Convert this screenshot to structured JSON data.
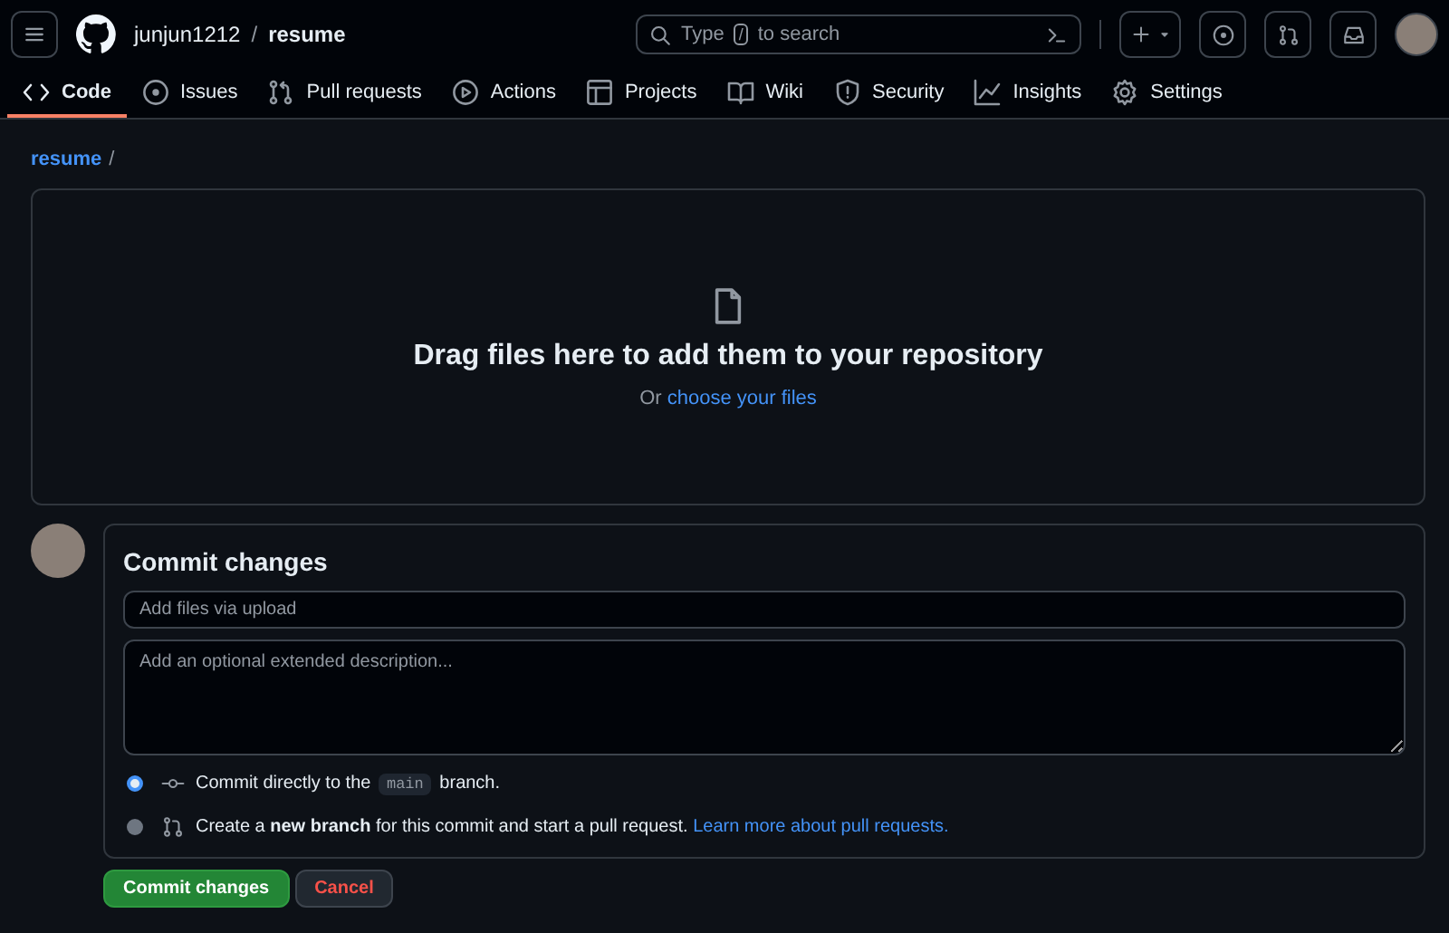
{
  "header": {
    "owner": "junjun1212",
    "separator": "/",
    "repo": "resume",
    "search": {
      "before": "Type",
      "key": "/",
      "after": "to search"
    }
  },
  "nav_tabs": [
    {
      "label": "Code",
      "selected": true
    },
    {
      "label": "Issues",
      "selected": false
    },
    {
      "label": "Pull requests",
      "selected": false
    },
    {
      "label": "Actions",
      "selected": false
    },
    {
      "label": "Projects",
      "selected": false
    },
    {
      "label": "Wiki",
      "selected": false
    },
    {
      "label": "Security",
      "selected": false
    },
    {
      "label": "Insights",
      "selected": false
    },
    {
      "label": "Settings",
      "selected": false
    }
  ],
  "breadcrumb": {
    "repo": "resume",
    "separator": "/"
  },
  "dropzone": {
    "title": "Drag files here to add them to your repository",
    "prompt": "Or",
    "link": "choose your files"
  },
  "commit": {
    "title": "Commit changes",
    "summary_placeholder": "Add files via upload",
    "description_placeholder": "Add an optional extended description...",
    "options": [
      {
        "kind": "direct",
        "prefix": "Commit directly to the",
        "branch": "main",
        "suffix": "branch.",
        "selected": true
      },
      {
        "kind": "new-branch",
        "text": "Create a **new branch** for this commit and start a pull request.",
        "link": "Learn more about pull requests.",
        "selected": false
      }
    ]
  },
  "buttons": [
    {
      "label": "Commit changes",
      "kind": "primary"
    },
    {
      "label": "Cancel",
      "kind": "danger"
    }
  ]
}
